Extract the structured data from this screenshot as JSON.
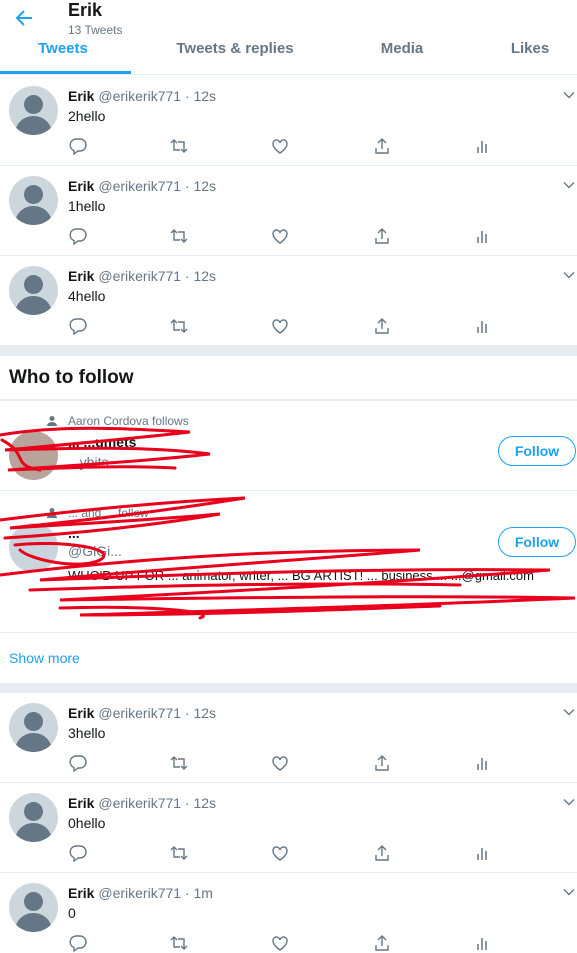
{
  "header": {
    "title": "Erik",
    "subtitle": "13 Tweets"
  },
  "tabs": [
    {
      "label": "Tweets",
      "active": true
    },
    {
      "label": "Tweets & replies",
      "active": false
    },
    {
      "label": "Media",
      "active": false
    },
    {
      "label": "Likes",
      "active": false
    }
  ],
  "tweets_top": [
    {
      "name": "Erik",
      "meta": "@erikerik771 · 12s",
      "text": "2hello"
    },
    {
      "name": "Erik",
      "meta": "@erikerik771 · 12s",
      "text": "1hello"
    },
    {
      "name": "Erik",
      "meta": "@erikerik771 · 12s",
      "text": "4hello"
    }
  ],
  "who_to_follow": {
    "title": "Who to follow",
    "suggestions": [
      {
        "social": "Aaron Cordova follows",
        "name": "... ...umets",
        "handle": "...ybits",
        "follow_label": "Follow"
      },
      {
        "social": "... and ... follow",
        "name": "...",
        "handle": "@GiGi...",
        "bio": "WHO'D UP FOR ... animator, writer, ... BG ARTIST! ... business ... ...@gmail.com",
        "follow_label": "Follow"
      }
    ],
    "show_more": "Show more"
  },
  "tweets_bottom": [
    {
      "name": "Erik",
      "meta": "@erikerik771 · 12s",
      "text": "3hello"
    },
    {
      "name": "Erik",
      "meta": "@erikerik771 · 12s",
      "text": "0hello"
    },
    {
      "name": "Erik",
      "meta": "@erikerik771 · 1m",
      "text": "0"
    }
  ],
  "colors": {
    "accent": "#1da1f2",
    "muted": "#657786",
    "border": "#e6ecf0",
    "redaction": "#e8001c"
  },
  "icons": [
    "back-arrow-icon",
    "chevron-down-icon",
    "reply-icon",
    "retweet-icon",
    "like-icon",
    "share-icon",
    "analytics-icon",
    "person-icon"
  ]
}
